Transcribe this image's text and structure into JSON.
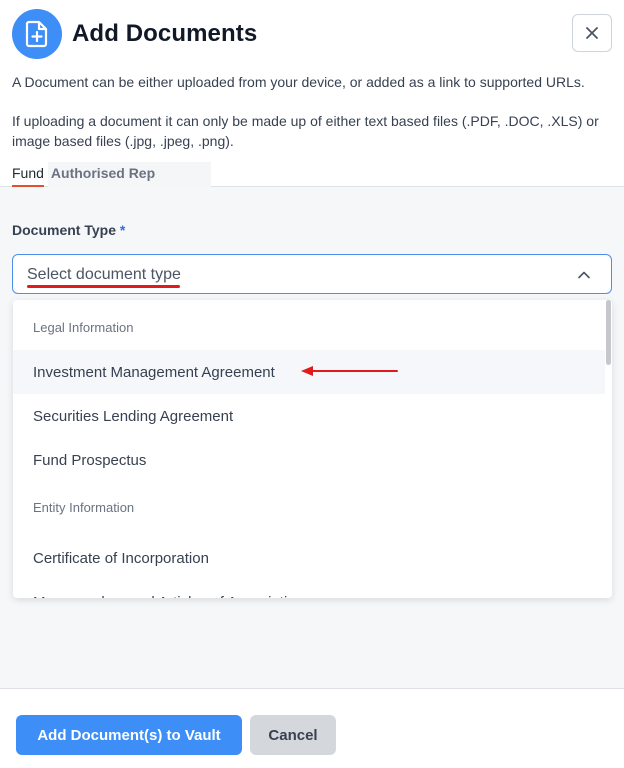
{
  "header": {
    "title": "Add Documents",
    "icon": "file-plus-icon",
    "close_icon": "close-icon",
    "description_1": "A Document can be either uploaded from your device, or added as a link to supported URLs.",
    "description_2": "If uploading a document it can only be made up of either text based files (.PDF, .DOC, .XLS) or image based files (.jpg, .jpeg, .png)."
  },
  "tabs": [
    {
      "label": "Fund",
      "active": true
    },
    {
      "label": "Authorised Rep",
      "active": false
    }
  ],
  "form": {
    "document_type_label": "Document Type",
    "required_marker": "*",
    "select_placeholder": "Select document type",
    "chevron_icon": "chevron-up-icon"
  },
  "dropdown": {
    "groups": [
      {
        "header": "Legal Information",
        "options": [
          "Investment Management Agreement",
          "Securities Lending Agreement",
          "Fund Prospectus"
        ]
      },
      {
        "header": "Entity Information",
        "options": [
          "Certificate of Incorporation",
          "Memorandum and Articles of Association"
        ]
      }
    ],
    "highlighted_option": "Investment Management Agreement"
  },
  "footer": {
    "primary_button": "Add Document(s) to Vault",
    "secondary_button": "Cancel"
  },
  "colors": {
    "accent": "#3d8ef7",
    "annotation_red": "#e01b1b",
    "tab_underline": "#e0522e"
  }
}
